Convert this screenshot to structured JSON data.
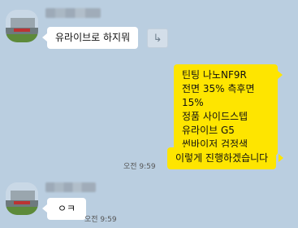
{
  "messages": {
    "m1": {
      "text": "유라이브로 하지뭐"
    },
    "share_icon": "↳",
    "m2": {
      "text": "틴팅 나노NF9R\n전면 35% 측후면15%\n정품 사이드스텝\n유라이브 G5\n썬바이저 검정색"
    },
    "m3": {
      "text": "이렇게 진행하겠습니다",
      "time": "오전 9:59"
    },
    "m4": {
      "text": "ㅇㅋ",
      "time": "오전 9:59"
    }
  },
  "colors": {
    "background": "#bacee0",
    "outgoing_bubble": "#fee500",
    "incoming_bubble": "#ffffff"
  }
}
